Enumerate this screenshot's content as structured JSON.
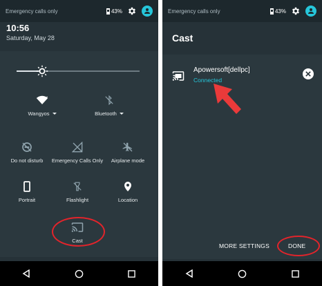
{
  "left_panel": {
    "status_bar": {
      "notice": "Emergency calls only",
      "battery": "43%"
    },
    "header": {
      "time": "10:56",
      "date": "Saturday, May 28"
    },
    "brightness_level": 0.21,
    "tiles": [
      {
        "label": "Wangyos",
        "icon": "wifi-icon",
        "has_dropdown": true
      },
      {
        "label": "Bluetooth",
        "icon": "bluetooth-off-icon",
        "has_dropdown": true
      },
      {
        "label": "Do not disturb",
        "icon": "do-not-disturb-icon",
        "has_dropdown": false
      },
      {
        "label": "Emergency Calls Only",
        "icon": "signal-off-icon",
        "has_dropdown": false
      },
      {
        "label": "Airplane mode",
        "icon": "airplane-mode-icon",
        "has_dropdown": false
      },
      {
        "label": "Portrait",
        "icon": "portrait-icon",
        "has_dropdown": false
      },
      {
        "label": "Flashlight",
        "icon": "flashlight-icon",
        "has_dropdown": false
      },
      {
        "label": "Location",
        "icon": "location-icon",
        "has_dropdown": false
      },
      {
        "label": "Cast",
        "icon": "cast-icon",
        "has_dropdown": false
      }
    ]
  },
  "right_panel": {
    "status_bar": {
      "notice": "Emergency calls only",
      "battery": "43%"
    },
    "title": "Cast",
    "device": {
      "name": "Apowersoft[dellpc]",
      "status": "Connected",
      "icon": "cast-connected-icon"
    },
    "buttons": {
      "more_settings": "MORE SETTINGS",
      "done": "DONE"
    }
  },
  "colors": {
    "panel_background": "#263238",
    "tile_background": "#2b383e",
    "accent": "#26c6da",
    "highlight_red": "#e3242b"
  },
  "nav": {
    "icons": [
      "back-icon",
      "home-icon",
      "recents-icon"
    ]
  }
}
